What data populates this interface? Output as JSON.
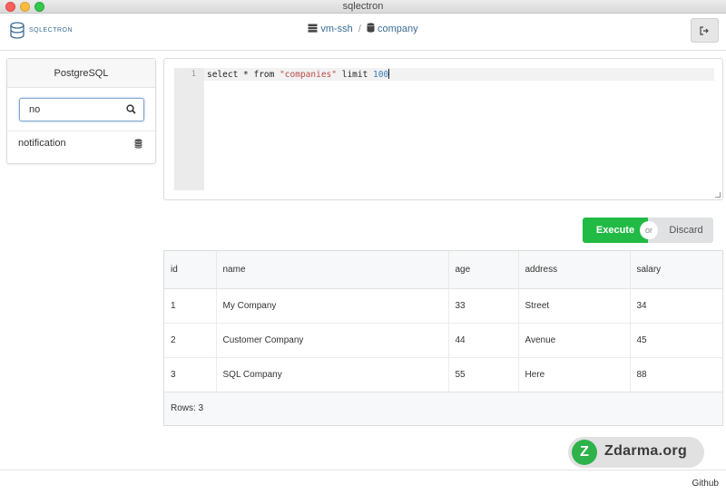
{
  "window": {
    "title": "sqlectron"
  },
  "header": {
    "logo_text": "SQLECTRON",
    "breadcrumb": {
      "server": "vm-ssh",
      "database": "company"
    }
  },
  "sidebar": {
    "title": "PostgreSQL",
    "search": {
      "value": "no",
      "placeholder": ""
    },
    "items": [
      {
        "label": "notification"
      }
    ]
  },
  "editor": {
    "line_number": "1",
    "query_keyword": "select * from ",
    "query_string": "\"companies\"",
    "query_limit": " limit ",
    "query_number": "100"
  },
  "actions": {
    "execute_label": "Execute",
    "or_label": "or",
    "discard_label": "Discard"
  },
  "results": {
    "columns": [
      "id",
      "name",
      "age",
      "address",
      "salary"
    ],
    "rows": [
      [
        "1",
        "My Company",
        "33",
        "Street",
        "34"
      ],
      [
        "2",
        "Customer Company",
        "44",
        "Avenue",
        "45"
      ],
      [
        "3",
        "SQL Company",
        "55",
        "Here",
        "88"
      ]
    ],
    "footer": "Rows: 3"
  },
  "watermark": {
    "text": "Zdarma.org",
    "glyph": "Z"
  },
  "statusbar": {
    "github_label": "Github"
  },
  "colors": {
    "accent": "#3b6c94",
    "execute": "#21ba45",
    "discard": "#e0e1e2"
  }
}
